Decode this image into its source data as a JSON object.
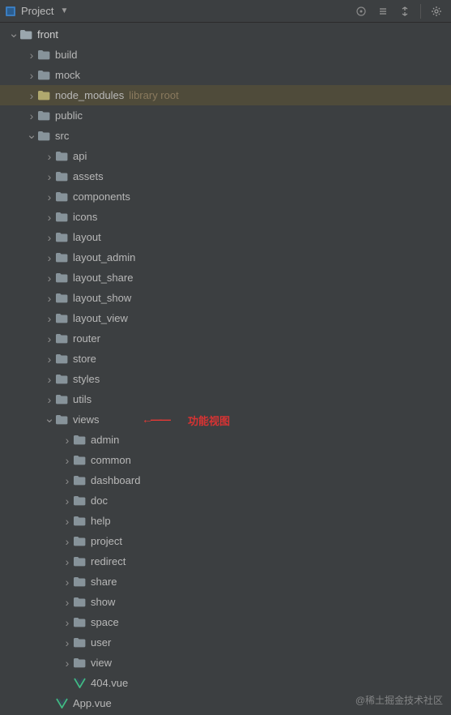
{
  "header": {
    "title": "Project"
  },
  "annotation": {
    "label": "功能视图"
  },
  "watermark": "@稀土掘金技术社区",
  "tree": [
    {
      "depth": 1,
      "exp": "open",
      "icon": "folder",
      "lit": true,
      "label": "front"
    },
    {
      "depth": 2,
      "exp": "closed",
      "icon": "folder",
      "label": "build"
    },
    {
      "depth": 2,
      "exp": "closed",
      "icon": "folder",
      "label": "mock"
    },
    {
      "depth": 2,
      "exp": "closed",
      "icon": "folder",
      "label": "node_modules",
      "suffix": "library root",
      "hl": true
    },
    {
      "depth": 2,
      "exp": "closed",
      "icon": "folder",
      "label": "public"
    },
    {
      "depth": 2,
      "exp": "open",
      "icon": "folder",
      "label": "src"
    },
    {
      "depth": 3,
      "exp": "closed",
      "icon": "folder",
      "label": "api"
    },
    {
      "depth": 3,
      "exp": "closed",
      "icon": "folder",
      "label": "assets"
    },
    {
      "depth": 3,
      "exp": "closed",
      "icon": "folder",
      "label": "components"
    },
    {
      "depth": 3,
      "exp": "closed",
      "icon": "folder",
      "label": "icons"
    },
    {
      "depth": 3,
      "exp": "closed",
      "icon": "folder",
      "label": "layout"
    },
    {
      "depth": 3,
      "exp": "closed",
      "icon": "folder",
      "label": "layout_admin"
    },
    {
      "depth": 3,
      "exp": "closed",
      "icon": "folder",
      "label": "layout_share"
    },
    {
      "depth": 3,
      "exp": "closed",
      "icon": "folder",
      "label": "layout_show"
    },
    {
      "depth": 3,
      "exp": "closed",
      "icon": "folder",
      "label": "layout_view"
    },
    {
      "depth": 3,
      "exp": "closed",
      "icon": "folder",
      "label": "router"
    },
    {
      "depth": 3,
      "exp": "closed",
      "icon": "folder",
      "label": "store"
    },
    {
      "depth": 3,
      "exp": "closed",
      "icon": "folder",
      "label": "styles"
    },
    {
      "depth": 3,
      "exp": "closed",
      "icon": "folder",
      "label": "utils"
    },
    {
      "depth": 3,
      "exp": "open",
      "icon": "folder",
      "label": "views",
      "annot": true
    },
    {
      "depth": 4,
      "exp": "closed",
      "icon": "folder",
      "label": "admin"
    },
    {
      "depth": 4,
      "exp": "closed",
      "icon": "folder",
      "label": "common"
    },
    {
      "depth": 4,
      "exp": "closed",
      "icon": "folder",
      "label": "dashboard"
    },
    {
      "depth": 4,
      "exp": "closed",
      "icon": "folder",
      "label": "doc"
    },
    {
      "depth": 4,
      "exp": "closed",
      "icon": "folder",
      "label": "help"
    },
    {
      "depth": 4,
      "exp": "closed",
      "icon": "folder",
      "label": "project"
    },
    {
      "depth": 4,
      "exp": "closed",
      "icon": "folder",
      "label": "redirect"
    },
    {
      "depth": 4,
      "exp": "closed",
      "icon": "folder",
      "label": "share"
    },
    {
      "depth": 4,
      "exp": "closed",
      "icon": "folder",
      "label": "show"
    },
    {
      "depth": 4,
      "exp": "closed",
      "icon": "folder",
      "label": "space"
    },
    {
      "depth": 4,
      "exp": "closed",
      "icon": "folder",
      "label": "user"
    },
    {
      "depth": 4,
      "exp": "closed",
      "icon": "folder",
      "label": "view"
    },
    {
      "depth": 4,
      "exp": "none",
      "icon": "vue",
      "label": "404.vue"
    },
    {
      "depth": 3,
      "exp": "none",
      "icon": "vue",
      "label": "App.vue"
    }
  ]
}
